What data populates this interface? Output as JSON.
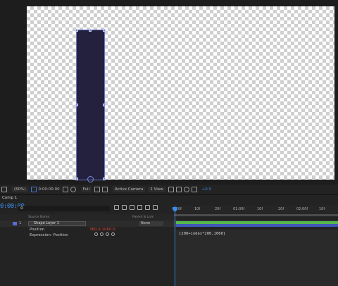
{
  "viewer": {
    "zoom": "(50%)",
    "timecode": "0:00:00:00",
    "resolution": "Full",
    "camera": "Active Camera",
    "view": "1 View",
    "exposure": "+0.0"
  },
  "timeline": {
    "comp_tab": "Comp 1",
    "timecode": "0:00:00",
    "search_placeholder": "",
    "columns": {
      "source_name": "Source Name",
      "parent_link": "Parent & Link"
    },
    "ruler_ticks": [
      "0f",
      "10f",
      "20f",
      "01:00f",
      "10f",
      "20f",
      "02:00f",
      "10f"
    ],
    "layer": {
      "number": "1",
      "name": "Shape Layer 1",
      "parent": "None",
      "label_color": "#5a6cd8"
    },
    "property": {
      "name": "Position",
      "value": "360.0,1060.0"
    },
    "expression_label": "Expression: Position",
    "expression_text": "[200+index*200,1060]"
  },
  "colors": {
    "accent": "#3d8be8",
    "shape_fill": "#24213f",
    "layer_bar": "#56b84c"
  }
}
